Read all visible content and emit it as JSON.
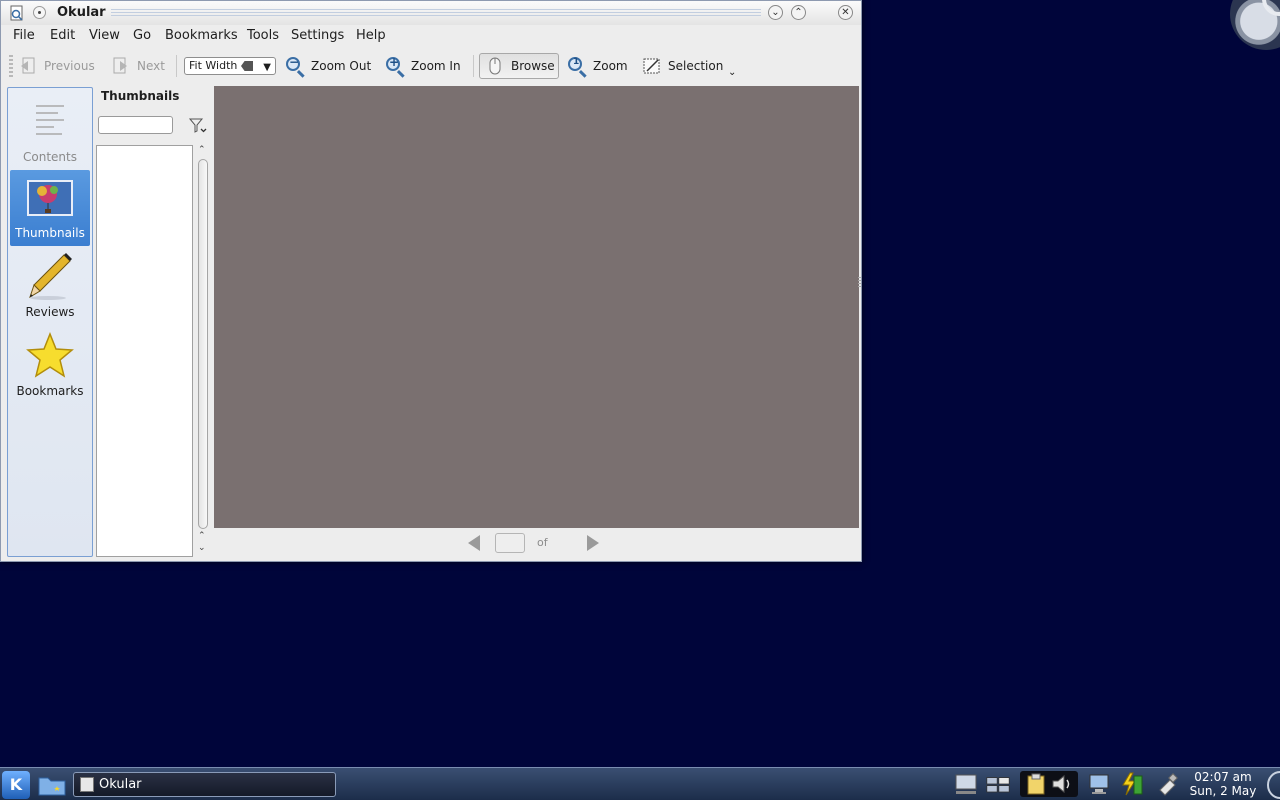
{
  "window": {
    "title": "Okular"
  },
  "menubar": {
    "items": [
      {
        "label": "File"
      },
      {
        "label": "Edit"
      },
      {
        "label": "View"
      },
      {
        "label": "Go"
      },
      {
        "label": "Bookmarks"
      },
      {
        "label": "Tools"
      },
      {
        "label": "Settings"
      },
      {
        "label": "Help"
      }
    ]
  },
  "toolbar": {
    "previous_label": "Previous",
    "next_label": "Next",
    "zoom_mode": "Fit Width",
    "zoom_out_label": "Zoom Out",
    "zoom_in_label": "Zoom In",
    "browse_label": "Browse",
    "zoom_tool_label": "Zoom",
    "selection_label": "Selection"
  },
  "sidebar": {
    "items": [
      {
        "label": "Contents",
        "icon": "contents-icon",
        "state": "disabled"
      },
      {
        "label": "Thumbnails",
        "icon": "thumbnails-icon",
        "state": "active"
      },
      {
        "label": "Reviews",
        "icon": "pencil-icon",
        "state": "normal"
      },
      {
        "label": "Bookmarks",
        "icon": "star-icon",
        "state": "normal"
      }
    ]
  },
  "thumbnails_panel": {
    "title": "Thumbnails",
    "search_value": ""
  },
  "pager": {
    "page_value": "",
    "of_label": "of"
  },
  "taskbar": {
    "task_label": "Okular",
    "clock_time": "02:07 am",
    "clock_date": "Sun, 2 May"
  },
  "colors": {
    "desktop": "#00053a",
    "page_view": "#7a7070",
    "selection": "#3b7ed0"
  }
}
